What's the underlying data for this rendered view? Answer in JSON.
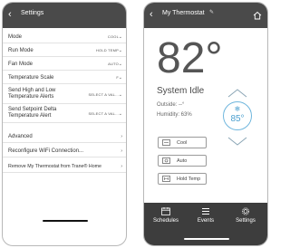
{
  "settings": {
    "title": "Settings",
    "rows": [
      {
        "label": "Mode",
        "value": "COOL"
      },
      {
        "label": "Run Mode",
        "value": "HOLD TEMP"
      },
      {
        "label": "Fan Mode",
        "value": "AUTO"
      },
      {
        "label": "Temperature Scale",
        "value": "F"
      },
      {
        "label": "Send High and Low\nTemperature Alerts",
        "value": "SELECT A VAL..."
      },
      {
        "label": "Send Setpoint Delta\nTemperature Alert",
        "value": "SELECT A VAL..."
      },
      {
        "label": "Advanced",
        "value": ""
      },
      {
        "label": "Reconfigure WiFi Connection...",
        "value": ""
      },
      {
        "label": "Remove My Thermostat from Trane® Home",
        "value": ""
      }
    ]
  },
  "thermostat": {
    "title": "My Thermostat",
    "current_temp": "82°",
    "status": "System Idle",
    "outside": "Outside: --°",
    "humidity": "Humidity: 63%",
    "setpoint": "85°",
    "buttons": [
      "Cool",
      "Auto",
      "Hold Temp"
    ],
    "nav": [
      "Schedules",
      "Events",
      "Settings"
    ]
  },
  "colors": {
    "header": "#4a4a4a",
    "accent": "#4a9fcf",
    "nav": "#3d3d3d"
  }
}
